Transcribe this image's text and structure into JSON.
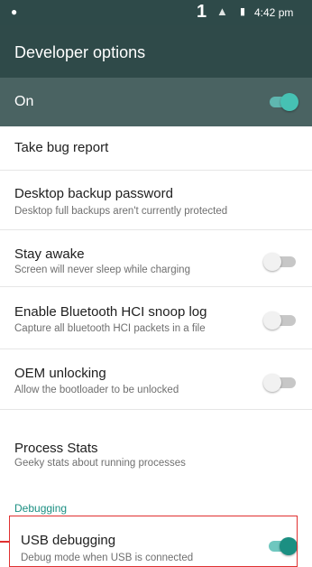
{
  "status_bar": {
    "notification_icon": "dot-icon",
    "number": "1",
    "signal_icon": "signal-icon",
    "battery_icon": "battery-icon",
    "time": "4:42 pm"
  },
  "app_bar": {
    "title": "Developer options"
  },
  "master_switch": {
    "label": "On",
    "state": true
  },
  "items": [
    {
      "title": "Take bug report"
    },
    {
      "title": "Desktop backup password",
      "subtitle": "Desktop full backups aren't currently protected"
    },
    {
      "title": "Stay awake",
      "subtitle": "Screen will never sleep while charging",
      "toggle": false
    },
    {
      "title": "Enable Bluetooth HCI snoop log",
      "subtitle": "Capture all bluetooth HCI packets in a file",
      "toggle": false
    },
    {
      "title": "OEM unlocking",
      "subtitle": "Allow the bootloader to be unlocked",
      "toggle": false
    },
    {
      "title": "Process Stats",
      "subtitle": "Geeky stats about running processes"
    }
  ],
  "section": {
    "label": "Debugging"
  },
  "usb_debugging": {
    "title": "USB debugging",
    "subtitle": "Debug mode when USB is connected",
    "toggle": true
  },
  "colors": {
    "accent": "#1b8f82",
    "toolbar": "#2f4a49",
    "highlight": "#e03030"
  }
}
